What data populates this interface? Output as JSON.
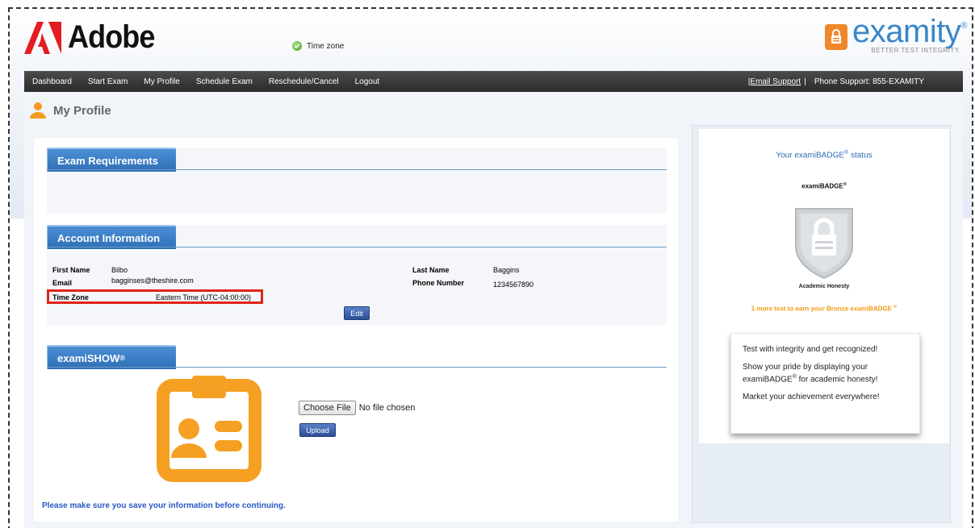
{
  "brand": {
    "adobe_text": "Adobe",
    "examity_text": "examity",
    "examity_reg": "®",
    "examity_tagline": "BETTER TEST INTEGRITY."
  },
  "nav": {
    "items": [
      "Dashboard",
      "Start Exam",
      "My Profile",
      "Schedule Exam",
      "Reschedule/Cancel",
      "Logout"
    ],
    "email_support": "|Email Support",
    "separator": "|",
    "phone_support": "Phone Support: 855-EXAMITY"
  },
  "page": {
    "title": "My Profile",
    "save_note": "Please make sure you save your information before continuing."
  },
  "exam_requirements": {
    "tab_label": "Exam Requirements",
    "time_zone_check": "Time zone"
  },
  "account": {
    "tab_label": "Account Information",
    "first_name_label": "First Name",
    "first_name": "Bilbo",
    "email_label": "Email",
    "email": "bagginses@theshire.com",
    "time_zone_label": "Time Zone",
    "time_zone": "Eastern Time (UTC-04:00:00)",
    "last_name_label": "Last Name",
    "last_name": "Baggins",
    "phone_label": "Phone Number",
    "phone": "1234567890",
    "edit_button": "Edit"
  },
  "examishow": {
    "tab_label": "examiSHOW",
    "tab_reg": "®",
    "choose_file_button": "Choose File",
    "no_file_text": "No file chosen",
    "upload_button": "Upload"
  },
  "badge_panel": {
    "status_prefix": "Your examiBADGE",
    "status_reg": "®",
    "status_suffix": " status",
    "badge_name": "examiBADGE",
    "badge_reg": "®",
    "badge_caption": "Academic Honesty",
    "earn_text": "1 more test to earn your Bronze examiBADGE",
    "earn_reg": "®",
    "promo_line1": "Test with integrity and get recognized!",
    "promo_line2_a": "Show your pride by displaying your examiBADGE",
    "promo_line2_reg": "®",
    "promo_line2_b": " for academic honesty!",
    "promo_line3": "Market your achievement everywhere!"
  },
  "colors": {
    "accent_blue": "#2f6fb5",
    "nav_bg": "#2b2b2b",
    "examity_orange": "#f0882b",
    "highlight_red": "#e2231a",
    "earn_orange": "#f39c12"
  }
}
